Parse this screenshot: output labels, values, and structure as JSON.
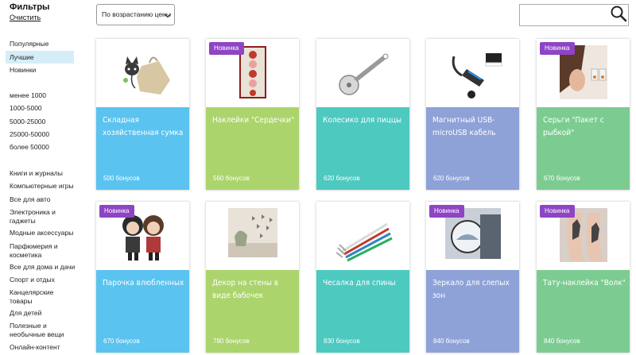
{
  "filters": {
    "title": "Фильтры",
    "clear": "Очистить",
    "sort_items": [
      "Популярные",
      "Лучшие",
      "Новинки"
    ],
    "price_items": [
      "менее 1000",
      "1000-5000",
      "5000-25000",
      "25000-50000",
      "более 50000"
    ],
    "categories": [
      "Книги и журналы",
      "Компьютерные игры",
      "Все для авто",
      "Электроника и гаджеты",
      "Модные аксессуары",
      "Парфюмерия и косметика",
      "Все для дома и дачи",
      "Спорт и отдых",
      "Канцелярские товары",
      "Для детей",
      "Полезные и необычные вещи",
      "Онлайн-контент"
    ]
  },
  "sort_select": {
    "value": "По возрастанию цены"
  },
  "search": {
    "placeholder": "",
    "icon": "search-icon"
  },
  "colors": {
    "blue": "#5bc3ef",
    "green": "#acd46d",
    "teal": "#4dc9c0",
    "periwinkle": "#8ea2d8",
    "mint": "#7ccc92",
    "badge": "#8e44c4"
  },
  "products": [
    {
      "name": "Складная хозяйственная сумка",
      "bonus": "500 бонусов",
      "badge": "",
      "color": "#5bc3ef"
    },
    {
      "name": "Наклейки \"Сердечки\"",
      "bonus": "560 бонусов",
      "badge": "Новинка",
      "color": "#acd46d"
    },
    {
      "name": "Колесико для пиццы",
      "bonus": "620 бонусов",
      "badge": "",
      "color": "#4dc9c0"
    },
    {
      "name": "Магнитный USB-microUSB кабель",
      "bonus": "620 бонусов",
      "badge": "",
      "color": "#8ea2d8"
    },
    {
      "name": "Серьги \"Пакет с рыбкой\"",
      "bonus": "670 бонусов",
      "badge": "Новинка",
      "color": "#7ccc92"
    },
    {
      "name": "Парочка влюбленных",
      "bonus": "670 бонусов",
      "badge": "Новинка",
      "color": "#5bc3ef"
    },
    {
      "name": "Декор на стены в виде бабочек",
      "bonus": "780 бонусов",
      "badge": "",
      "color": "#acd46d"
    },
    {
      "name": "Чесалка для спины",
      "bonus": "830 бонусов",
      "badge": "",
      "color": "#4dc9c0"
    },
    {
      "name": "Зеркало для слепых зон",
      "bonus": "840 бонусов",
      "badge": "Новинка",
      "color": "#8ea2d8"
    },
    {
      "name": "Тату-наклейка \"Волк\"",
      "bonus": "840 бонусов",
      "badge": "Новинка",
      "color": "#7ccc92"
    }
  ]
}
